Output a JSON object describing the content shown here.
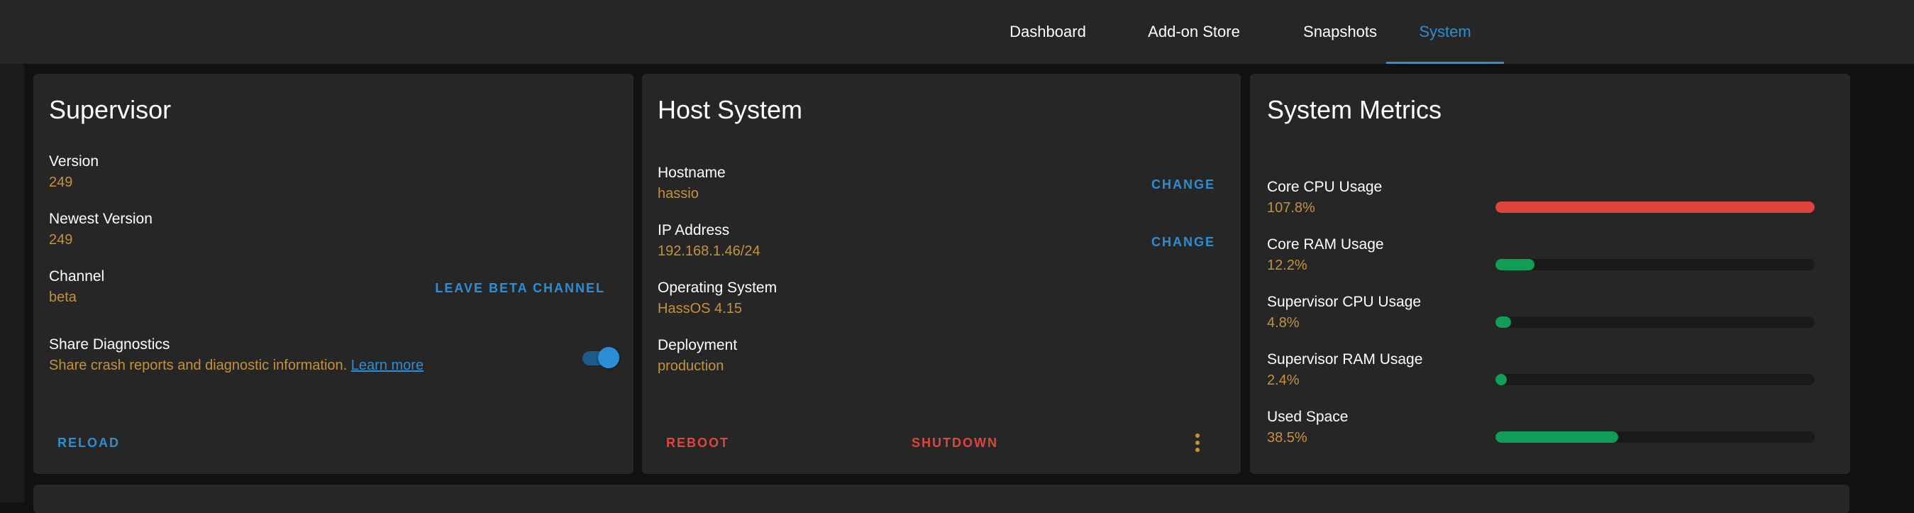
{
  "nav": {
    "tabs": [
      {
        "label": "Dashboard"
      },
      {
        "label": "Add-on Store"
      },
      {
        "label": "Snapshots"
      },
      {
        "label": "System"
      }
    ],
    "active_tab": "System"
  },
  "supervisor": {
    "title": "Supervisor",
    "version_label": "Version",
    "version_value": "249",
    "newest_label": "Newest Version",
    "newest_value": "249",
    "channel_label": "Channel",
    "channel_value": "beta",
    "leave_beta_label": "LEAVE BETA CHANNEL",
    "diagnostics_label": "Share Diagnostics",
    "diagnostics_desc": "Share crash reports and diagnostic information.",
    "learn_more": "Learn more",
    "diagnostics_enabled": true,
    "reload_label": "RELOAD"
  },
  "host": {
    "title": "Host System",
    "hostname_label": "Hostname",
    "hostname_value": "hassio",
    "ip_label": "IP Address",
    "ip_value": "192.168.1.46/24",
    "os_label": "Operating System",
    "os_value": "HassOS 4.15",
    "deployment_label": "Deployment",
    "deployment_value": "production",
    "change_label": "CHANGE",
    "reboot_label": "REBOOT",
    "shutdown_label": "SHUTDOWN"
  },
  "metrics": {
    "title": "System Metrics",
    "items": [
      {
        "label": "Core CPU Usage",
        "value": "107.8%",
        "fraction": 1.0,
        "color": "#e0453d"
      },
      {
        "label": "Core RAM Usage",
        "value": "12.2%",
        "fraction": 0.122,
        "color": "#0f9d58"
      },
      {
        "label": "Supervisor CPU Usage",
        "value": "4.8%",
        "fraction": 0.048,
        "color": "#0f9d58"
      },
      {
        "label": "Supervisor RAM Usage",
        "value": "2.4%",
        "fraction": 0.024,
        "color": "#0f9d58"
      },
      {
        "label": "Used Space",
        "value": "38.5%",
        "fraction": 0.385,
        "color": "#0f9d58"
      }
    ]
  },
  "colors": {
    "accent": "#2c8fd6",
    "value_text": "#c4923a",
    "danger": "#e0453d",
    "ok": "#0f9d58"
  },
  "icons": {
    "more_menu": "dots-vertical-icon"
  }
}
